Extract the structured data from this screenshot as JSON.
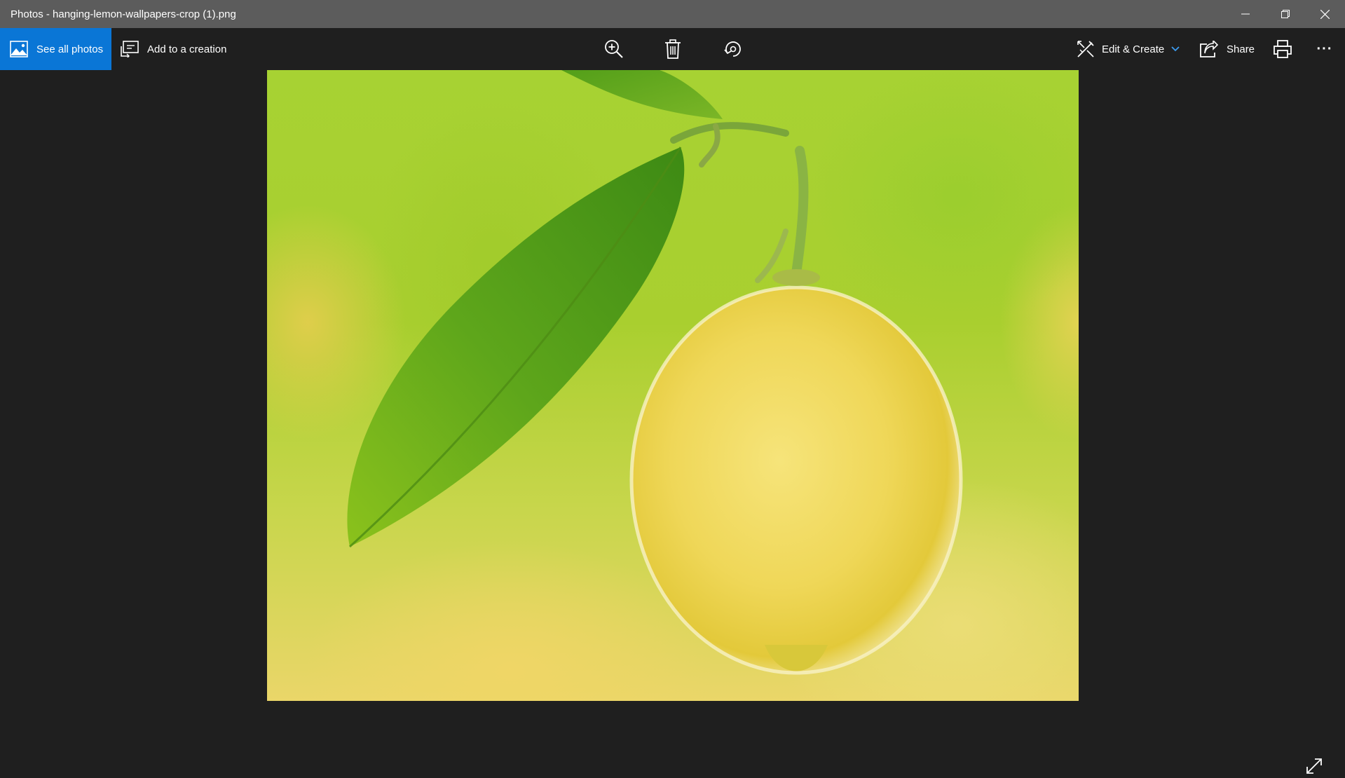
{
  "window": {
    "title": "Photos - hanging-lemon-wallpapers-crop (1).png"
  },
  "toolbar": {
    "see_all_photos_label": "See all photos",
    "add_to_creation_label": "Add to a creation",
    "edit_create_label": "Edit & Create",
    "share_label": "Share",
    "more_label": "···"
  },
  "icons": {
    "minimize": "minimize-icon",
    "restore": "restore-icon",
    "close": "close-icon",
    "photos": "photos-icon",
    "add_to_creation": "add-to-creation-icon",
    "zoom": "zoom-in-icon",
    "delete": "delete-icon",
    "rotate": "rotate-icon",
    "edit_create": "edit-create-icon",
    "chevron": "chevron-down-icon",
    "share": "share-icon",
    "print": "print-icon",
    "fullscreen": "fullscreen-icon"
  },
  "photo": {
    "subject": "lemon-with-leaf"
  },
  "colors": {
    "titlebar_bg": "#5c5c5c",
    "app_bg": "#1f1f1f",
    "accent": "#0a76d6"
  }
}
